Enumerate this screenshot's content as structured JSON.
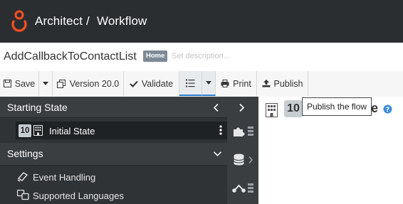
{
  "header": {
    "crumbs": [
      "Architect",
      "/",
      "Workflow"
    ]
  },
  "flow": {
    "name": "AddCallbackToContactList",
    "badge": "Home",
    "description_placeholder": "Set description..."
  },
  "toolbar": {
    "save": "Save",
    "version": "Version 20.0",
    "validate": "Validate",
    "print": "Print",
    "publish": "Publish"
  },
  "tooltip": "Publish the flow",
  "left_panel": {
    "starting_state_title": "Starting State",
    "state_number": "10",
    "state_name": "Initial State",
    "settings_title": "Settings",
    "settings_items": [
      "Event Handling",
      "Supported Languages"
    ]
  },
  "canvas": {
    "state_number": "10",
    "title_fragment": "e"
  },
  "colors": {
    "header_bg": "#2b2e31",
    "brand_orange": "#ff4f1f",
    "panel_dark": "#2f3336",
    "active_underline": "#2a7fcf"
  }
}
